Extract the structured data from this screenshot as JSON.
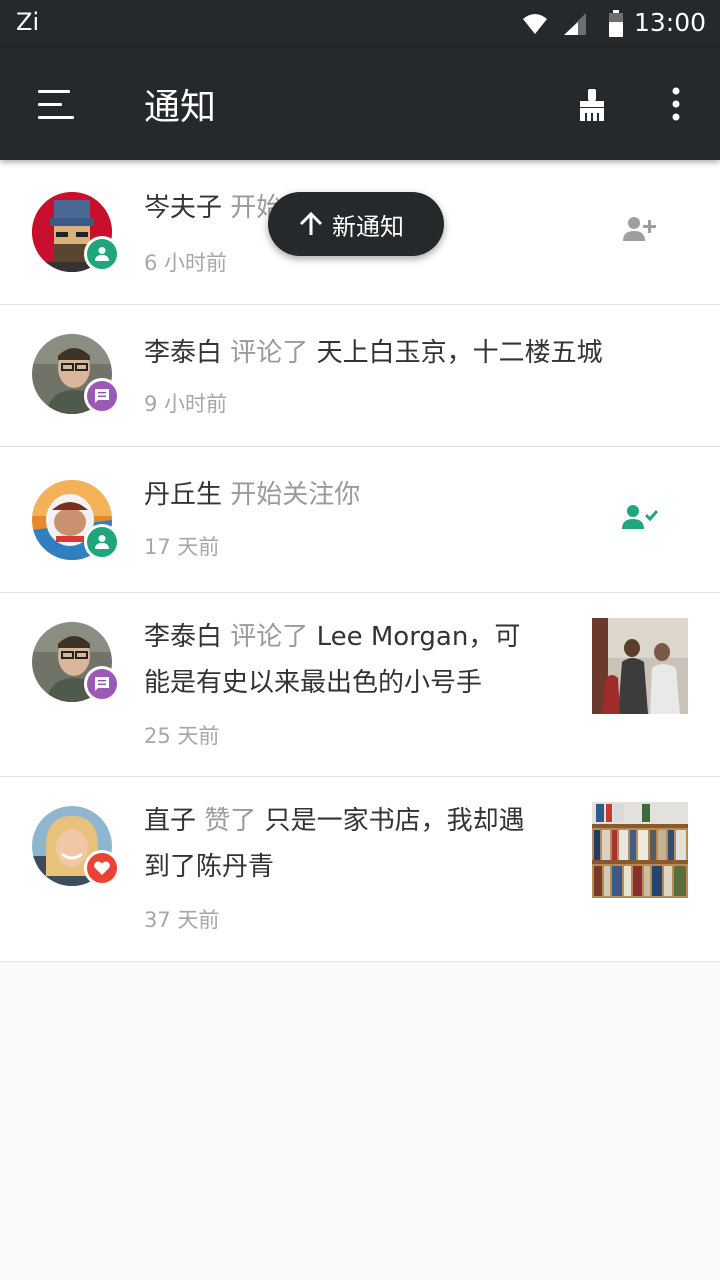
{
  "status_bar": {
    "carrier": "Zi",
    "time": "13:00",
    "icons": [
      "wifi-icon",
      "signal-icon",
      "battery-icon"
    ]
  },
  "app_bar": {
    "title": "通知",
    "icons": [
      "menu-icon",
      "clear-all-icon",
      "more-vert-icon"
    ]
  },
  "new_notice_pill": {
    "label": "新通知",
    "icon": "arrow-up-icon"
  },
  "notifications": [
    {
      "user": "岑夫子",
      "verb": "开始关注你",
      "target": "",
      "time": "6 小时前",
      "badge": "person-icon",
      "badge_color": "#1fa67a",
      "action": "person-add-icon"
    },
    {
      "user": "李泰白",
      "verb": "评论了",
      "target": "天上白玉京，十二楼五城",
      "time": "9 小时前",
      "badge": "comment-icon",
      "badge_color": "#9b59b6"
    },
    {
      "user": "丹丘生",
      "verb": "开始关注你",
      "target": "",
      "time": "17 天前",
      "badge": "person-icon",
      "badge_color": "#1fa67a",
      "action": "person-check-icon"
    },
    {
      "user": "李泰白",
      "verb": "评论了",
      "target_line1": "Lee Morgan，可",
      "target_line2": "能是有史以来最出色的小号手",
      "time": "25 天前",
      "badge": "comment-icon",
      "badge_color": "#9b59b6",
      "thumbnail": "concert-photo"
    },
    {
      "user": "直子",
      "verb": "赞了",
      "target_line1": "只是一家书店，我却遇",
      "target_line2": "到了陈丹青",
      "time": "37 天前",
      "badge": "heart-icon",
      "badge_color": "#ea4335",
      "thumbnail": "bookshelf-photo"
    }
  ],
  "colors": {
    "bar": "#25292b",
    "follow_green": "#1fa67a",
    "comment_purple": "#9b59b6",
    "like_red": "#ea4335"
  }
}
